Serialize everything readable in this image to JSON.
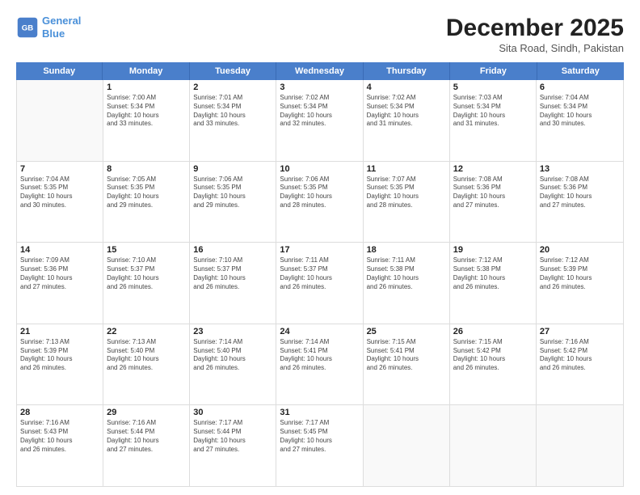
{
  "header": {
    "logo_line1": "General",
    "logo_line2": "Blue",
    "month": "December 2025",
    "location": "Sita Road, Sindh, Pakistan"
  },
  "days": [
    "Sunday",
    "Monday",
    "Tuesday",
    "Wednesday",
    "Thursday",
    "Friday",
    "Saturday"
  ],
  "weeks": [
    [
      {
        "day": "",
        "lines": []
      },
      {
        "day": "1",
        "lines": [
          "Sunrise: 7:00 AM",
          "Sunset: 5:34 PM",
          "Daylight: 10 hours",
          "and 33 minutes."
        ]
      },
      {
        "day": "2",
        "lines": [
          "Sunrise: 7:01 AM",
          "Sunset: 5:34 PM",
          "Daylight: 10 hours",
          "and 33 minutes."
        ]
      },
      {
        "day": "3",
        "lines": [
          "Sunrise: 7:02 AM",
          "Sunset: 5:34 PM",
          "Daylight: 10 hours",
          "and 32 minutes."
        ]
      },
      {
        "day": "4",
        "lines": [
          "Sunrise: 7:02 AM",
          "Sunset: 5:34 PM",
          "Daylight: 10 hours",
          "and 31 minutes."
        ]
      },
      {
        "day": "5",
        "lines": [
          "Sunrise: 7:03 AM",
          "Sunset: 5:34 PM",
          "Daylight: 10 hours",
          "and 31 minutes."
        ]
      },
      {
        "day": "6",
        "lines": [
          "Sunrise: 7:04 AM",
          "Sunset: 5:34 PM",
          "Daylight: 10 hours",
          "and 30 minutes."
        ]
      }
    ],
    [
      {
        "day": "7",
        "lines": [
          "Sunrise: 7:04 AM",
          "Sunset: 5:35 PM",
          "Daylight: 10 hours",
          "and 30 minutes."
        ]
      },
      {
        "day": "8",
        "lines": [
          "Sunrise: 7:05 AM",
          "Sunset: 5:35 PM",
          "Daylight: 10 hours",
          "and 29 minutes."
        ]
      },
      {
        "day": "9",
        "lines": [
          "Sunrise: 7:06 AM",
          "Sunset: 5:35 PM",
          "Daylight: 10 hours",
          "and 29 minutes."
        ]
      },
      {
        "day": "10",
        "lines": [
          "Sunrise: 7:06 AM",
          "Sunset: 5:35 PM",
          "Daylight: 10 hours",
          "and 28 minutes."
        ]
      },
      {
        "day": "11",
        "lines": [
          "Sunrise: 7:07 AM",
          "Sunset: 5:35 PM",
          "Daylight: 10 hours",
          "and 28 minutes."
        ]
      },
      {
        "day": "12",
        "lines": [
          "Sunrise: 7:08 AM",
          "Sunset: 5:36 PM",
          "Daylight: 10 hours",
          "and 27 minutes."
        ]
      },
      {
        "day": "13",
        "lines": [
          "Sunrise: 7:08 AM",
          "Sunset: 5:36 PM",
          "Daylight: 10 hours",
          "and 27 minutes."
        ]
      }
    ],
    [
      {
        "day": "14",
        "lines": [
          "Sunrise: 7:09 AM",
          "Sunset: 5:36 PM",
          "Daylight: 10 hours",
          "and 27 minutes."
        ]
      },
      {
        "day": "15",
        "lines": [
          "Sunrise: 7:10 AM",
          "Sunset: 5:37 PM",
          "Daylight: 10 hours",
          "and 26 minutes."
        ]
      },
      {
        "day": "16",
        "lines": [
          "Sunrise: 7:10 AM",
          "Sunset: 5:37 PM",
          "Daylight: 10 hours",
          "and 26 minutes."
        ]
      },
      {
        "day": "17",
        "lines": [
          "Sunrise: 7:11 AM",
          "Sunset: 5:37 PM",
          "Daylight: 10 hours",
          "and 26 minutes."
        ]
      },
      {
        "day": "18",
        "lines": [
          "Sunrise: 7:11 AM",
          "Sunset: 5:38 PM",
          "Daylight: 10 hours",
          "and 26 minutes."
        ]
      },
      {
        "day": "19",
        "lines": [
          "Sunrise: 7:12 AM",
          "Sunset: 5:38 PM",
          "Daylight: 10 hours",
          "and 26 minutes."
        ]
      },
      {
        "day": "20",
        "lines": [
          "Sunrise: 7:12 AM",
          "Sunset: 5:39 PM",
          "Daylight: 10 hours",
          "and 26 minutes."
        ]
      }
    ],
    [
      {
        "day": "21",
        "lines": [
          "Sunrise: 7:13 AM",
          "Sunset: 5:39 PM",
          "Daylight: 10 hours",
          "and 26 minutes."
        ]
      },
      {
        "day": "22",
        "lines": [
          "Sunrise: 7:13 AM",
          "Sunset: 5:40 PM",
          "Daylight: 10 hours",
          "and 26 minutes."
        ]
      },
      {
        "day": "23",
        "lines": [
          "Sunrise: 7:14 AM",
          "Sunset: 5:40 PM",
          "Daylight: 10 hours",
          "and 26 minutes."
        ]
      },
      {
        "day": "24",
        "lines": [
          "Sunrise: 7:14 AM",
          "Sunset: 5:41 PM",
          "Daylight: 10 hours",
          "and 26 minutes."
        ]
      },
      {
        "day": "25",
        "lines": [
          "Sunrise: 7:15 AM",
          "Sunset: 5:41 PM",
          "Daylight: 10 hours",
          "and 26 minutes."
        ]
      },
      {
        "day": "26",
        "lines": [
          "Sunrise: 7:15 AM",
          "Sunset: 5:42 PM",
          "Daylight: 10 hours",
          "and 26 minutes."
        ]
      },
      {
        "day": "27",
        "lines": [
          "Sunrise: 7:16 AM",
          "Sunset: 5:42 PM",
          "Daylight: 10 hours",
          "and 26 minutes."
        ]
      }
    ],
    [
      {
        "day": "28",
        "lines": [
          "Sunrise: 7:16 AM",
          "Sunset: 5:43 PM",
          "Daylight: 10 hours",
          "and 26 minutes."
        ]
      },
      {
        "day": "29",
        "lines": [
          "Sunrise: 7:16 AM",
          "Sunset: 5:44 PM",
          "Daylight: 10 hours",
          "and 27 minutes."
        ]
      },
      {
        "day": "30",
        "lines": [
          "Sunrise: 7:17 AM",
          "Sunset: 5:44 PM",
          "Daylight: 10 hours",
          "and 27 minutes."
        ]
      },
      {
        "day": "31",
        "lines": [
          "Sunrise: 7:17 AM",
          "Sunset: 5:45 PM",
          "Daylight: 10 hours",
          "and 27 minutes."
        ]
      },
      {
        "day": "",
        "lines": []
      },
      {
        "day": "",
        "lines": []
      },
      {
        "day": "",
        "lines": []
      }
    ]
  ]
}
